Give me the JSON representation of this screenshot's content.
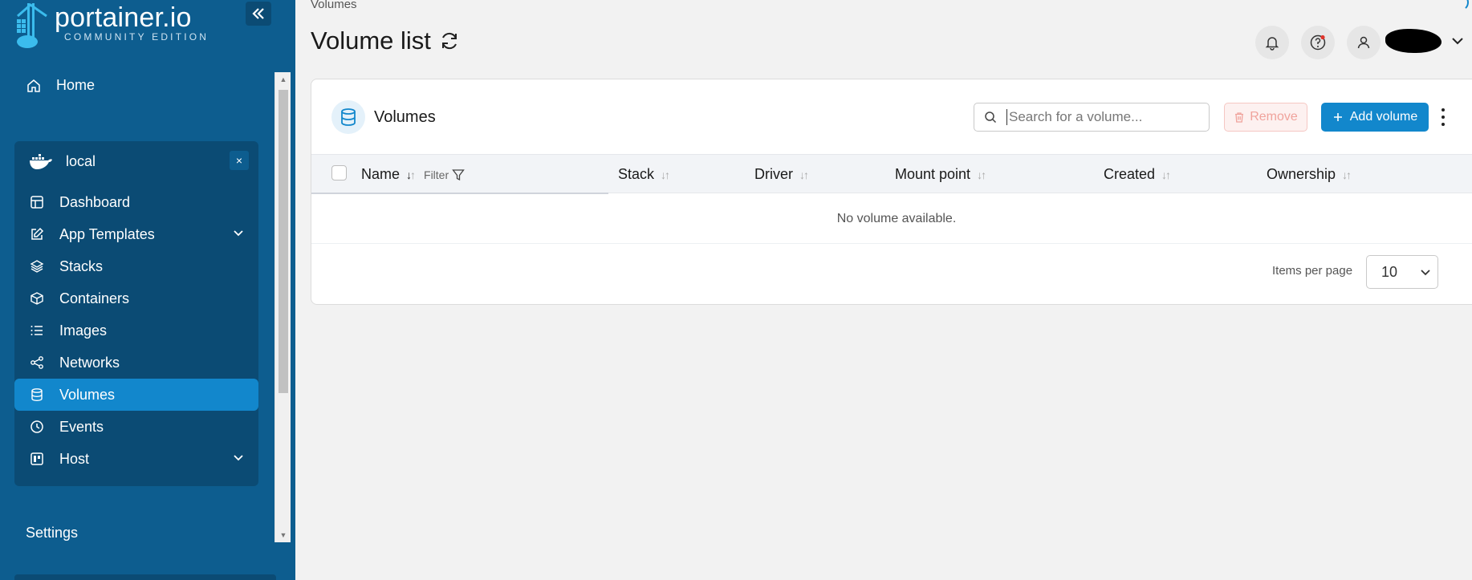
{
  "app": {
    "logo_name": "portainer.io",
    "logo_edition": "COMMUNITY EDITION",
    "accent": "#1287cc",
    "sidebar_bg": "#0d5d8f"
  },
  "sidebar": {
    "home_label": "Home",
    "environment": {
      "name": "local",
      "close_label": "×",
      "items": [
        {
          "label": "Dashboard",
          "icon": "dashboard-icon"
        },
        {
          "label": "App Templates",
          "icon": "edit-icon",
          "expandable": true
        },
        {
          "label": "Stacks",
          "icon": "layers-icon"
        },
        {
          "label": "Containers",
          "icon": "box-icon"
        },
        {
          "label": "Images",
          "icon": "list-icon"
        },
        {
          "label": "Networks",
          "icon": "share-icon"
        },
        {
          "label": "Volumes",
          "icon": "database-icon",
          "active": true
        },
        {
          "label": "Events",
          "icon": "clock-icon"
        },
        {
          "label": "Host",
          "icon": "host-icon",
          "expandable": true
        }
      ]
    },
    "settings_label": "Settings"
  },
  "header": {
    "breadcrumb": "Volumes",
    "title": "Volume list"
  },
  "card": {
    "title": "Volumes",
    "search_placeholder": "Search for a volume...",
    "remove_label": "Remove",
    "add_label": "Add volume",
    "columns": {
      "name": "Name",
      "filter": "Filter",
      "stack": "Stack",
      "driver": "Driver",
      "mount_point": "Mount point",
      "created": "Created",
      "ownership": "Ownership"
    },
    "empty_message": "No volume available.",
    "items_per_page_label": "Items per page",
    "items_per_page_value": "10"
  }
}
